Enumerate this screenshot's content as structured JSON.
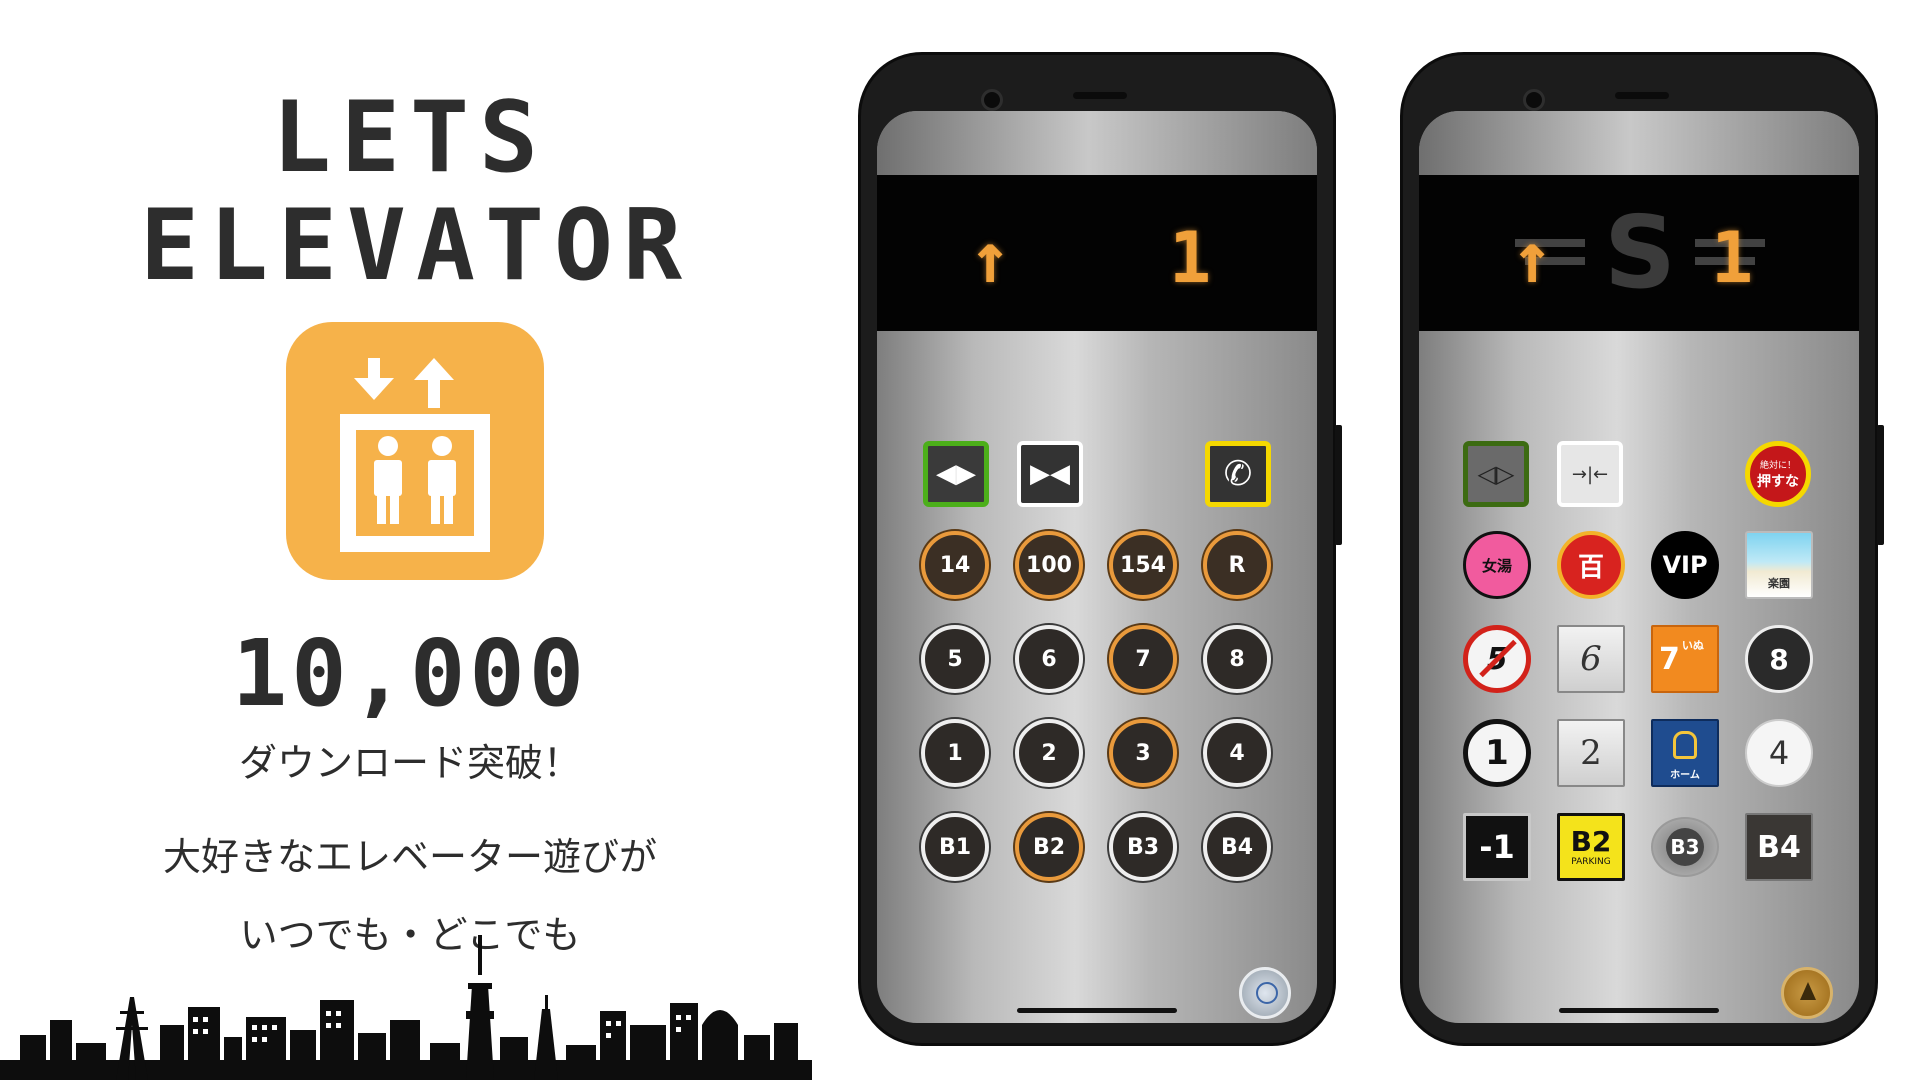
{
  "promo": {
    "title_line1": "LETS",
    "title_line2": "ELEVATOR",
    "downloads": "10,000",
    "milestone": "ダウンロード突破！",
    "tagline_line1": "大好きなエレベーター遊びが",
    "tagline_line2": "いつでも・どこでも",
    "icon_color": "#f6b24a"
  },
  "phone1": {
    "display": {
      "direction_icon": "up-arrow-icon",
      "arrow": "↑",
      "floor": "1"
    },
    "controls": [
      {
        "name": "door-open-button",
        "icon": "door-open-icon",
        "glyph": "◀▶",
        "border": "#4caf1a"
      },
      {
        "name": "door-close-button",
        "icon": "door-close-icon",
        "glyph": "▶◀",
        "border": "#ffffff"
      },
      {
        "name": "call-button",
        "icon": "phone-icon",
        "glyph": "✆",
        "border": "#f5d800"
      }
    ],
    "rows": [
      [
        {
          "label": "14",
          "lit": true
        },
        {
          "label": "100",
          "lit": true
        },
        {
          "label": "154",
          "lit": true
        },
        {
          "label": "R",
          "lit": true
        }
      ],
      [
        {
          "label": "5",
          "lit": false
        },
        {
          "label": "6",
          "lit": false
        },
        {
          "label": "7",
          "lit": true
        },
        {
          "label": "8",
          "lit": false
        }
      ],
      [
        {
          "label": "1",
          "lit": false
        },
        {
          "label": "2",
          "lit": false
        },
        {
          "label": "3",
          "lit": true
        },
        {
          "label": "4",
          "lit": false
        }
      ],
      [
        {
          "label": "B1",
          "lit": false
        },
        {
          "label": "B2",
          "lit": true
        },
        {
          "label": "B3",
          "lit": false
        },
        {
          "label": "B4",
          "lit": false
        }
      ]
    ],
    "corner_button_icon": "bell-icon"
  },
  "phone2": {
    "display": {
      "direction_icon": "up-arrow-icon",
      "arrow": "↑",
      "logo": "S",
      "floor": "1"
    },
    "controls": [
      {
        "name": "door-open-button",
        "icon": "door-open-icon",
        "glyph": "◁▷",
        "border": "#3c6b12"
      },
      {
        "name": "door-close-button",
        "icon": "door-close-icon",
        "glyph": "→|←",
        "border": "#ffffff"
      },
      {
        "name": "dont-push-button",
        "icon": "dont-push-icon",
        "label_small": "絶対に！",
        "label": "押すな",
        "border": "#f5d800"
      }
    ],
    "rows": [
      [
        {
          "label": "女湯",
          "style": "onsen"
        },
        {
          "label": "百",
          "style": "hyaku"
        },
        {
          "label": "VIP",
          "style": "vip"
        },
        {
          "label": "楽園",
          "style": "rakuen"
        }
      ],
      [
        {
          "label": "5",
          "style": "prohibit"
        },
        {
          "label": "6",
          "style": "plate"
        },
        {
          "label": "7",
          "sub": "いぬ",
          "style": "dog"
        },
        {
          "label": "8",
          "style": "dots"
        }
      ],
      [
        {
          "label": "1",
          "style": "white-ring"
        },
        {
          "label": "2",
          "style": "plate"
        },
        {
          "label": "ホーム",
          "style": "train"
        },
        {
          "label": "4",
          "style": "white-round"
        }
      ],
      [
        {
          "label": "-1",
          "style": "black-plate"
        },
        {
          "label": "B2",
          "sub": "PARKING",
          "style": "parking"
        },
        {
          "label": "B3",
          "style": "oval"
        },
        {
          "label": "B4",
          "style": "dark-plate"
        }
      ]
    ],
    "corner_button_icon": "bell-icon"
  }
}
